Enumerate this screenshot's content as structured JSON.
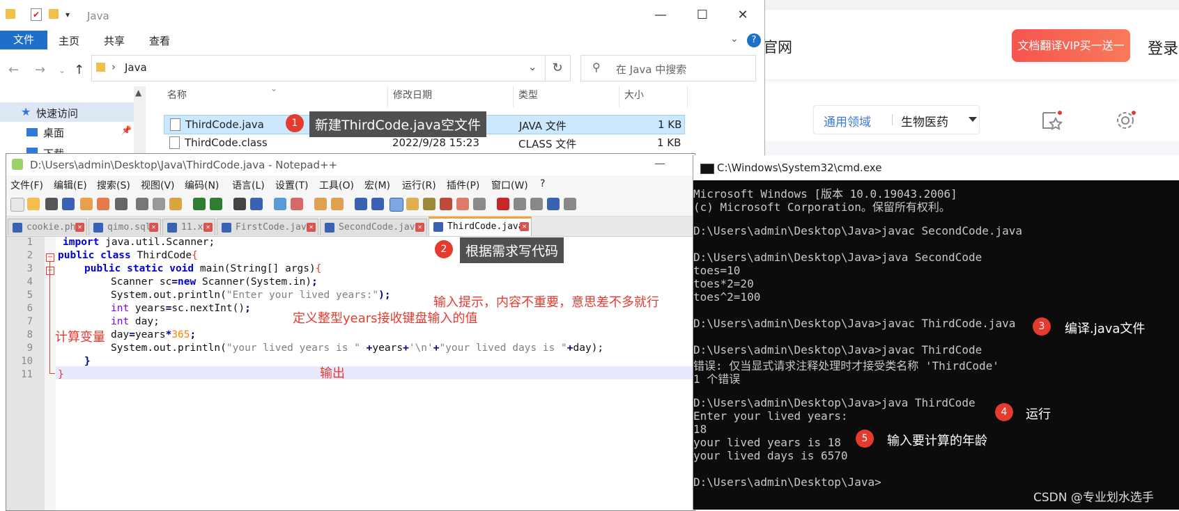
{
  "web": {
    "site_fragment": "官网",
    "vip_button": "文档翻译VIP买一送一",
    "login": "登录",
    "field_label": "通用领域",
    "field_value": "生物医药"
  },
  "explorer": {
    "title": "Java",
    "ribbon": {
      "file": "文件",
      "home": "主页",
      "share": "共享",
      "view": "查看"
    },
    "address": "Java",
    "search_placeholder": "在 Java 中搜索",
    "sidebar": {
      "quick_access": "快速访问",
      "desktop": "桌面",
      "downloads": "下载"
    },
    "columns": {
      "name": "名称",
      "modified": "修改日期",
      "type": "类型",
      "size": "大小"
    },
    "files": [
      {
        "name": "ThirdCode.java",
        "modified": "",
        "type": "JAVA 文件",
        "size": "1 KB"
      },
      {
        "name": "ThirdCode.class",
        "modified": "2022/9/28 15:23",
        "type": "CLASS 文件",
        "size": "1 KB"
      }
    ]
  },
  "notepad": {
    "title": "D:\\Users\\admin\\Desktop\\Java\\ThirdCode.java - Notepad++",
    "menu": [
      "文件(F)",
      "编辑(E)",
      "搜索(S)",
      "视图(V)",
      "编码(N)",
      "语言(L)",
      "设置(T)",
      "工具(O)",
      "宏(M)",
      "运行(R)",
      "插件(P)",
      "窗口(W)",
      "?"
    ],
    "tabs": [
      "cookie.php",
      "qimo.sql",
      "11.x",
      "FirstCode.java",
      "SecondCode.java",
      "ThirdCode.java"
    ],
    "line_numbers": [
      "1",
      "2",
      "3",
      "4",
      "5",
      "6",
      "7",
      "8",
      "9",
      "10",
      "11"
    ],
    "code": {
      "l1_kw": "import",
      "l1_rest": " java.util.Scanner;",
      "l2_kw": "public class",
      "l2_rest": " ThirdCode",
      "l2_brace": "{",
      "l3_kw": "public static void",
      "l3_rest": " main(String[] args)",
      "l3_brace": "{",
      "l4_a": "Scanner sc",
      "l4_op": "=",
      "l4_kw": "new",
      "l4_b": " Scanner(System.in)",
      "l4_end": ";",
      "l5_a": "System.out.println(",
      "l5_str": "\"Enter your lived years:\"",
      "l5_end": ");",
      "l6_ty": "int",
      "l6_a": " years",
      "l6_op": "=",
      "l6_b": "sc.nextInt()",
      "l6_end": ";",
      "l7_ty": "int",
      "l7_a": " day;",
      "l8_a": "day",
      "l8_op": "=",
      "l8_b": "years",
      "l8_op2": "*",
      "l8_num": "365",
      "l8_end": ";",
      "l9_a": "System.out.println(",
      "l9_s1": "\"your lived years is \"",
      "l9_p1": " +",
      "l9_b": "years",
      "l9_p2": "+",
      "l9_s2": "'\\n'",
      "l9_p3": "+",
      "l9_s3": "\"your lived days is \"",
      "l9_p4": "+",
      "l9_c": "day);",
      "l10": "}",
      "l11": "}"
    }
  },
  "cmd": {
    "title": "C:\\Windows\\System32\\cmd.exe",
    "lines": [
      "Microsoft Windows [版本 10.0.19043.2006]",
      "(c) Microsoft Corporation。保留所有权利。",
      "",
      "D:\\Users\\admin\\Desktop\\Java>javac SecondCode.java",
      "",
      "D:\\Users\\admin\\Desktop\\Java>java SecondCode",
      "toes=10",
      "toes*2=20",
      "toes^2=100",
      "",
      "D:\\Users\\admin\\Desktop\\Java>javac ThirdCode.java",
      "",
      "D:\\Users\\admin\\Desktop\\Java>javac ThirdCode",
      "错误: 仅当显式请求注释处理时才接受类名称 'ThirdCode'",
      "1 个错误",
      "",
      "D:\\Users\\admin\\Desktop\\Java>java ThirdCode",
      "Enter your lived years:",
      "18",
      "your lived years is 18",
      "your lived days is 6570",
      "",
      "D:\\Users\\admin\\Desktop\\Java>"
    ]
  },
  "annotations": {
    "b1": "1",
    "t1": "新建ThirdCode.java空文件",
    "b2": "2",
    "t2": "根据需求写代码",
    "b3": "3",
    "t3": "编译.java文件",
    "b4": "4",
    "t4": "运行",
    "b5": "5",
    "t5": "输入要计算的年龄",
    "r1": "输入提示，内容不重要，意思差不多就行",
    "r2": "定义整型years接收键盘输入的值",
    "r3": "计算变量",
    "r4": "输出"
  },
  "watermark": "CSDN @专业划水选手",
  "colors": {
    "accent_red": "#e53b2f",
    "explorer_blue": "#1e6fc8",
    "selection": "#cce8ff",
    "tab_orange": "#f4a33c"
  }
}
